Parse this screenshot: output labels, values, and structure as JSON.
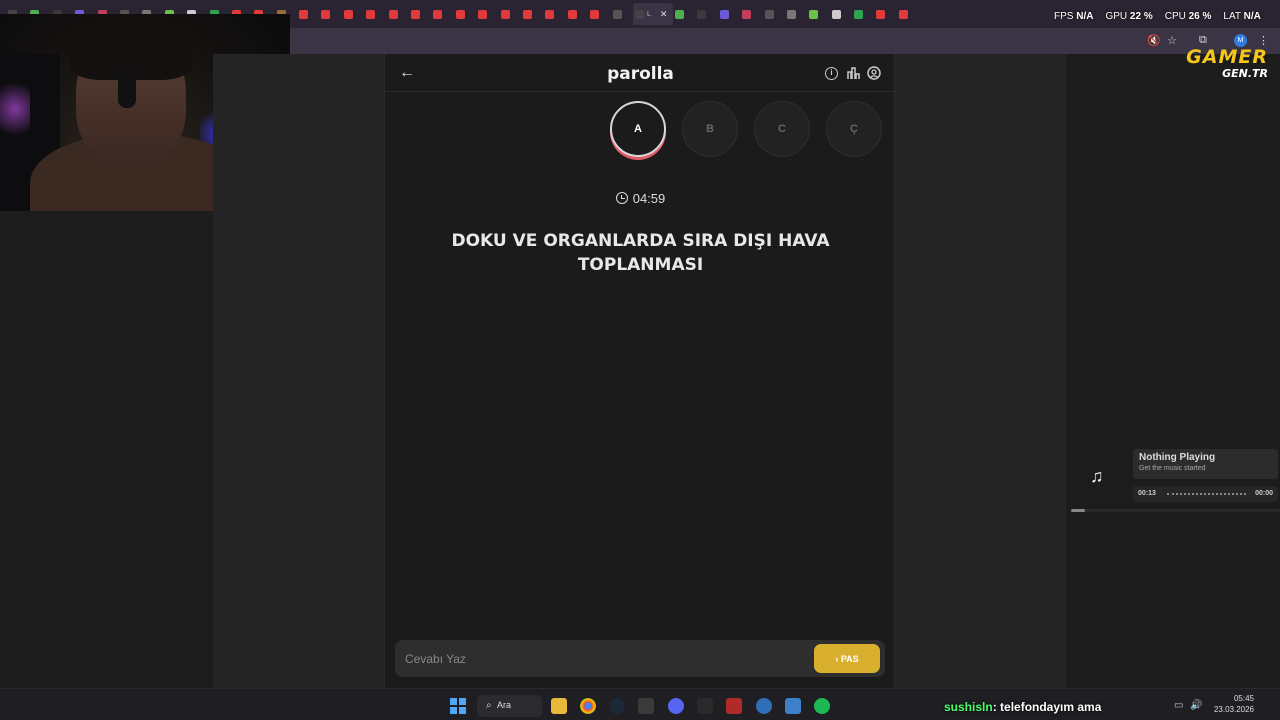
{
  "browser": {
    "tab_count": 40,
    "active_tab_label": "L",
    "active_tab_close": "✕"
  },
  "overlay": {
    "stats": [
      {
        "label": "FPS",
        "value": "N/A"
      },
      {
        "label": "GPU",
        "value": "22 %"
      },
      {
        "label": "CPU",
        "value": "26 %"
      },
      {
        "label": "LAT",
        "value": "N/A"
      }
    ],
    "logo_line1": "GAMER",
    "logo_line2": "GEN.TR"
  },
  "app": {
    "title": "parolla",
    "back_icon": "arrow-left-icon",
    "header_icons": [
      "info-icon",
      "chart-icon",
      "user-circle-icon"
    ],
    "letters": [
      {
        "label": "A",
        "state": "active"
      },
      {
        "label": "B",
        "state": "idle"
      },
      {
        "label": "C",
        "state": "idle"
      },
      {
        "label": "Ç",
        "state": "idle"
      }
    ],
    "timer": "04:59",
    "question": "DOKU VE ORGANLARDA SIRA DIŞI HAVA TOPLANMASI",
    "answer_placeholder": "Cevabı Yaz",
    "pass_label": "PAS",
    "pass_icon": "chevron-right-icon",
    "accent_color": "#d8b02e"
  },
  "music": {
    "title": "Nothing Playing",
    "subtitle": "Get the music started",
    "elapsed": "00:13",
    "total": "00:00"
  },
  "taskbar": {
    "search_label": "Ara",
    "chat_user": "sushisln",
    "chat_message": ": telefondayım ama",
    "time": "05:45",
    "date": "23.03.2026"
  }
}
